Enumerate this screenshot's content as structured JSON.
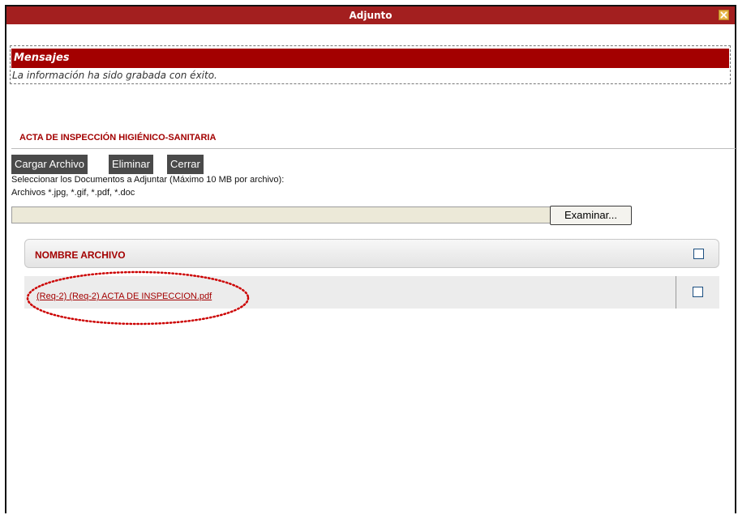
{
  "window": {
    "title": "Adjunto"
  },
  "messages": {
    "header": "Mensajes",
    "text": "La información ha sido grabada con éxito."
  },
  "section": {
    "title": "ACTA DE INSPECCIÓN HIGIÉNICO-SANITARIA"
  },
  "toolbar": {
    "upload_label": "Cargar Archivo",
    "delete_label": "Eliminar",
    "close_label": "Cerrar"
  },
  "instructions": {
    "line1": "Seleccionar los Documentos a Adjuntar (Máximo 10 MB por archivo):",
    "line2": "Archivos *.jpg, *.gif, *.pdf, *.doc"
  },
  "file_input": {
    "value": "",
    "browse_label": "Examinar..."
  },
  "grid": {
    "header": "NOMBRE ARCHIVO",
    "rows": [
      {
        "name": "(Req-2) (Req-2) ACTA DE INSPECCION.pdf",
        "checked": false
      }
    ]
  },
  "colors": {
    "title_bar": "#a31f1f",
    "accent_red": "#a30000",
    "button_dark": "#4a4a4a",
    "highlight": "#cc0000"
  }
}
